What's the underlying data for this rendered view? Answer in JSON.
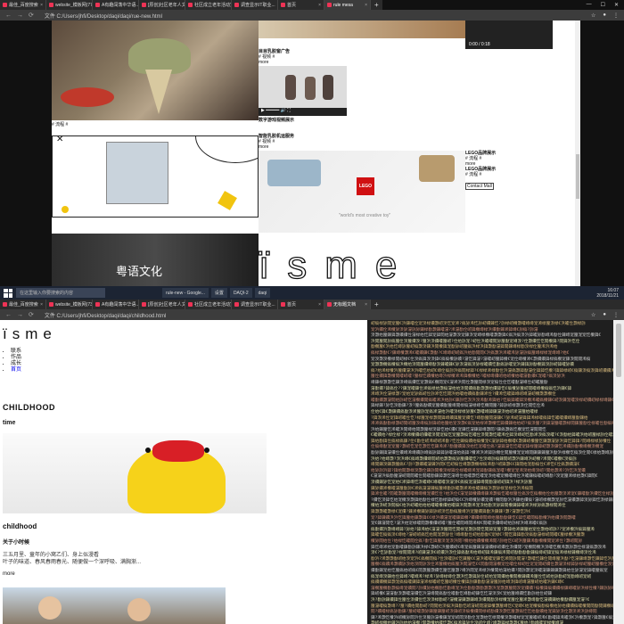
{
  "screen1": {
    "tabs": [
      "最佳_百度搜索",
      "website_模板网(7735753885)",
      "A有趣闯荡中华语...",
      "[原创]社区老年人文...",
      "社区成立老年活动室...",
      "调查显示IT职业...",
      "首页",
      "rule mesa"
    ],
    "url": "文件  C:/Users/jhfi/Desktop/daqi/daqi/rue-new.html",
    "captions": {
      "left_caption": "# 流程 #",
      "r1_title": "目目乳胶窗广告",
      "r1_tag": "# 视频 #",
      "r1_more": "more",
      "r2_title": "数字游戏视频展示",
      "r3_title": "智能乳胶机运服务",
      "r3_tag": "# 视频 #",
      "r3_more": "more",
      "lego1": "LEGO品牌展示",
      "lego1_tag": "# 流程 #",
      "lego1_more": "more",
      "lego2": "LEGO品牌展示",
      "lego2_tag": "# 流程 #",
      "contact": "Contact Mall",
      "lego_logo": "LEGO",
      "lego_slogan": "\"world's most creative toy\"",
      "banner_text": "粤语文化",
      "big_logo": "ïsme",
      "video_time": "0:00 / 0:18"
    },
    "taskbar": {
      "search_placeholder": "在这里输入你要搜索的内容",
      "apps": [
        "rule-new - Google...",
        "设置",
        "DAQI-2",
        "daqi"
      ],
      "clock_time": "16:07",
      "clock_date": "2018/11/21"
    }
  },
  "screen2": {
    "tabs": [
      "最佳_百度搜索",
      "website_模板网(735753885)",
      "A有趣闯荡中华语...",
      "[原创]社区老年人文化...",
      "社区成立老年活动室...",
      "调查显示IT职业...",
      "首页",
      "无标题文档"
    ],
    "url": "文件  C:/Users/jhfi/Desktop/daqi/daqi/childhood.html",
    "logo": "ïsme",
    "nav": [
      "联系",
      "作品",
      "成长",
      "首页"
    ],
    "heading": "CHILDHOOD",
    "subheading": "time",
    "section_title": "childhood",
    "section_sub": "关于小时候",
    "para1": "三五月里、童年的小窝乙们、身上似漫看",
    "para2": "叶子的味道、春风春雨春光、随便做一个深呼吸、满胸渐...",
    "more": "more"
  },
  "colors": {
    "chrome_dark": "#2b2b2b",
    "code_bg": "#1f1f1f",
    "code_yellow": "#d7ba7d",
    "code_orange": "#ce9178"
  }
}
